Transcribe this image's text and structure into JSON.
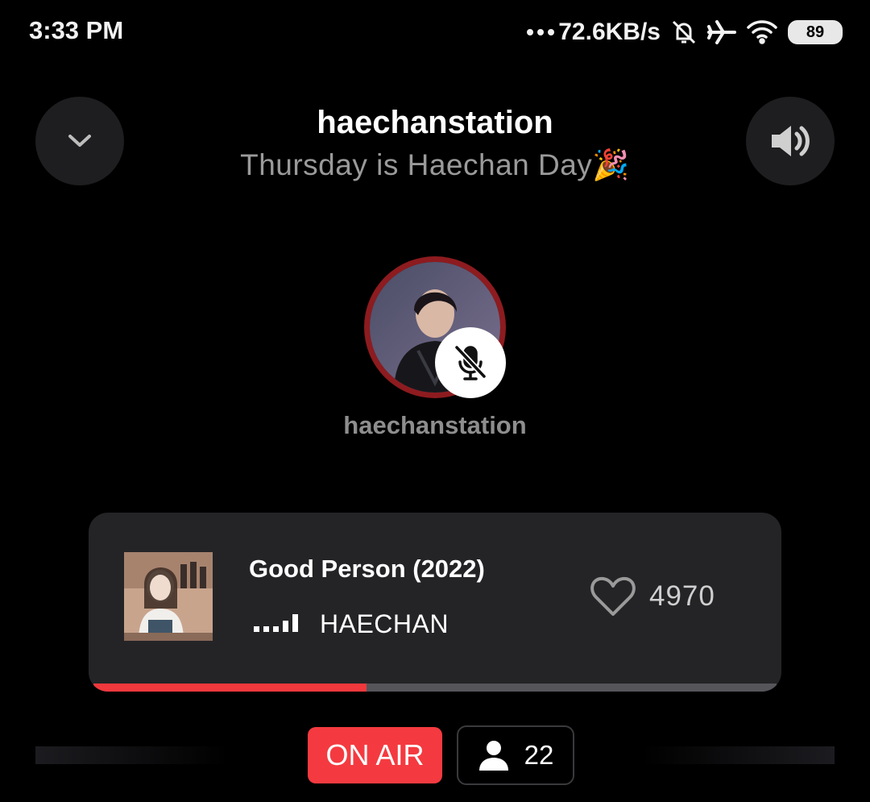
{
  "status_bar": {
    "time": "3:33 PM",
    "network_speed": "72.6KB/s",
    "battery": "89",
    "icons": [
      "more-dots-icon",
      "bell-muted-icon",
      "airplane-icon",
      "wifi-icon",
      "battery-icon"
    ]
  },
  "header": {
    "title": "haechanstation",
    "subtitle": "Thursday is Haechan Day🎉",
    "collapse_icon": "chevron-down-icon",
    "volume_icon": "speaker-icon"
  },
  "host": {
    "name": "haechanstation",
    "mic_status": "muted",
    "ring_color": "#8d1b1f"
  },
  "now_playing": {
    "title": "Good Person (2022)",
    "artist": "HAECHAN",
    "likes": "4970",
    "progress": 0.4
  },
  "footer": {
    "on_air_label": "ON AIR",
    "listener_count": "22"
  },
  "colors": {
    "accent": "#f43a40",
    "card_bg": "#242427",
    "background": "#000000"
  }
}
